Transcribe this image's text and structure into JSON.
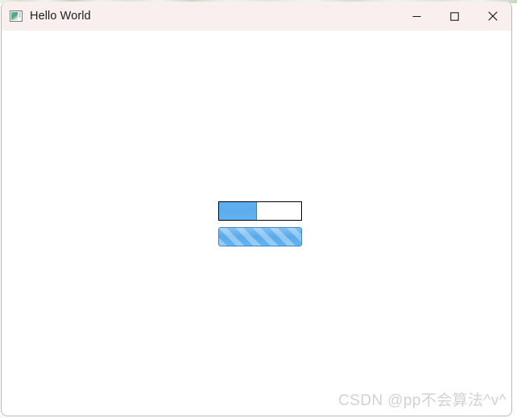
{
  "window": {
    "title": "Hello World",
    "icon": "app-image-icon",
    "titlebar_color": "#f8efee",
    "border_color": "#b9b9b9",
    "background_color": "#ffffff",
    "controls": [
      {
        "name": "minimize",
        "label": "Minimize",
        "glyph": "—"
      },
      {
        "name": "maximize",
        "label": "Maximize",
        "glyph": "□"
      },
      {
        "name": "close",
        "label": "Close",
        "glyph": "✕"
      }
    ]
  },
  "main": {
    "progress_bars": [
      {
        "name": "determinate-progress-bar",
        "style": "determinate",
        "value": 45,
        "min": 0,
        "max": 100,
        "fill_color": "#5cacec",
        "track_color": "#ffffff",
        "border_color": "#000000",
        "text_visible": false
      },
      {
        "name": "indeterminate-progress-bar",
        "style": "indeterminate-striped",
        "value": 100,
        "min": 0,
        "max": 100,
        "fill_color": "#5aaaea",
        "stripe_color": "#9fd0f5",
        "border_color": "#3c86c4",
        "text_visible": false
      }
    ]
  },
  "watermark": {
    "text": "CSDN @pp不会算法^v^",
    "color": "#d2d2d2"
  }
}
